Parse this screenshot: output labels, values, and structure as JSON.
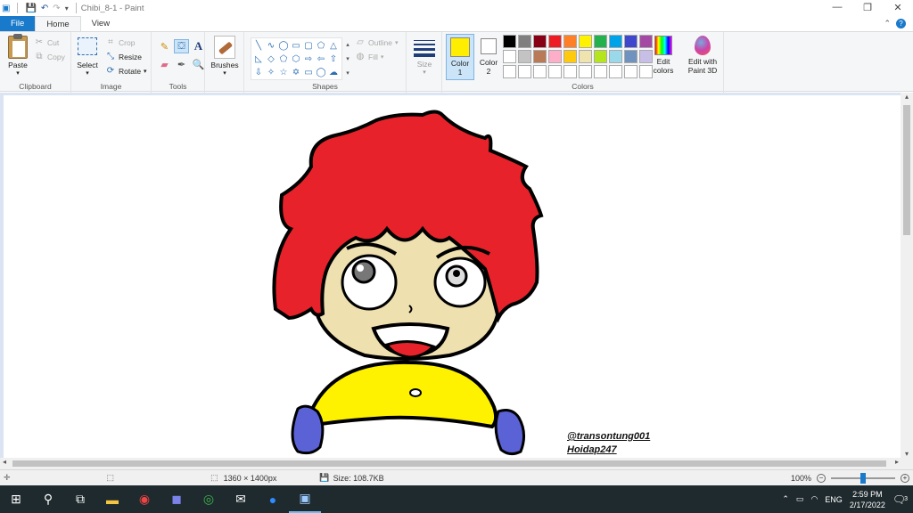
{
  "window": {
    "title": "Chibi_8-1 - Paint",
    "controls": [
      "minimize",
      "restore",
      "close"
    ]
  },
  "tabs": {
    "file": "File",
    "home": "Home",
    "view": "View"
  },
  "ribbon": {
    "clipboard": {
      "label": "Clipboard",
      "paste": "Paste",
      "cut": "Cut",
      "copy": "Copy"
    },
    "image": {
      "label": "Image",
      "select": "Select",
      "crop": "Crop",
      "resize": "Resize",
      "rotate": "Rotate"
    },
    "tools": {
      "label": "Tools"
    },
    "brushes": {
      "label": "Brushes"
    },
    "shapes": {
      "label": "Shapes",
      "outline": "Outline",
      "fill": "Fill"
    },
    "size": {
      "label": "Size"
    },
    "colors": {
      "label": "Colors",
      "color1_label": "Color",
      "color1_num": "1",
      "color2_label": "Color",
      "color2_num": "2",
      "color1": "#ffee00",
      "color2": "#ffffff",
      "edit_colors": "Edit colors",
      "edit_paint3d": "Edit with Paint 3D",
      "palette": [
        "#000000",
        "#7f7f7f",
        "#880015",
        "#ed1c24",
        "#ff7f27",
        "#fff200",
        "#22b14c",
        "#00a2e8",
        "#3f48cc",
        "#a349a4",
        "#ffffff",
        "#c3c3c3",
        "#b97a57",
        "#ffaec9",
        "#ffc90e",
        "#efe4b0",
        "#b5e61d",
        "#99d9ea",
        "#7092be",
        "#c8bfe7",
        "#ffffff",
        "#ffffff",
        "#ffffff",
        "#ffffff",
        "#ffffff",
        "#ffffff",
        "#ffffff",
        "#ffffff",
        "#ffffff",
        "#ffffff"
      ]
    }
  },
  "canvas": {
    "watermark_line1": "@transontung001",
    "watermark_line2": "Hoidap247"
  },
  "status": {
    "dimensions": "1360 × 1400px",
    "size": "Size: 108.7KB",
    "zoom": "100%"
  },
  "taskbar": {
    "lang": "ENG",
    "time": "2:59 PM",
    "date": "2/17/2022",
    "notification_count": "3"
  }
}
